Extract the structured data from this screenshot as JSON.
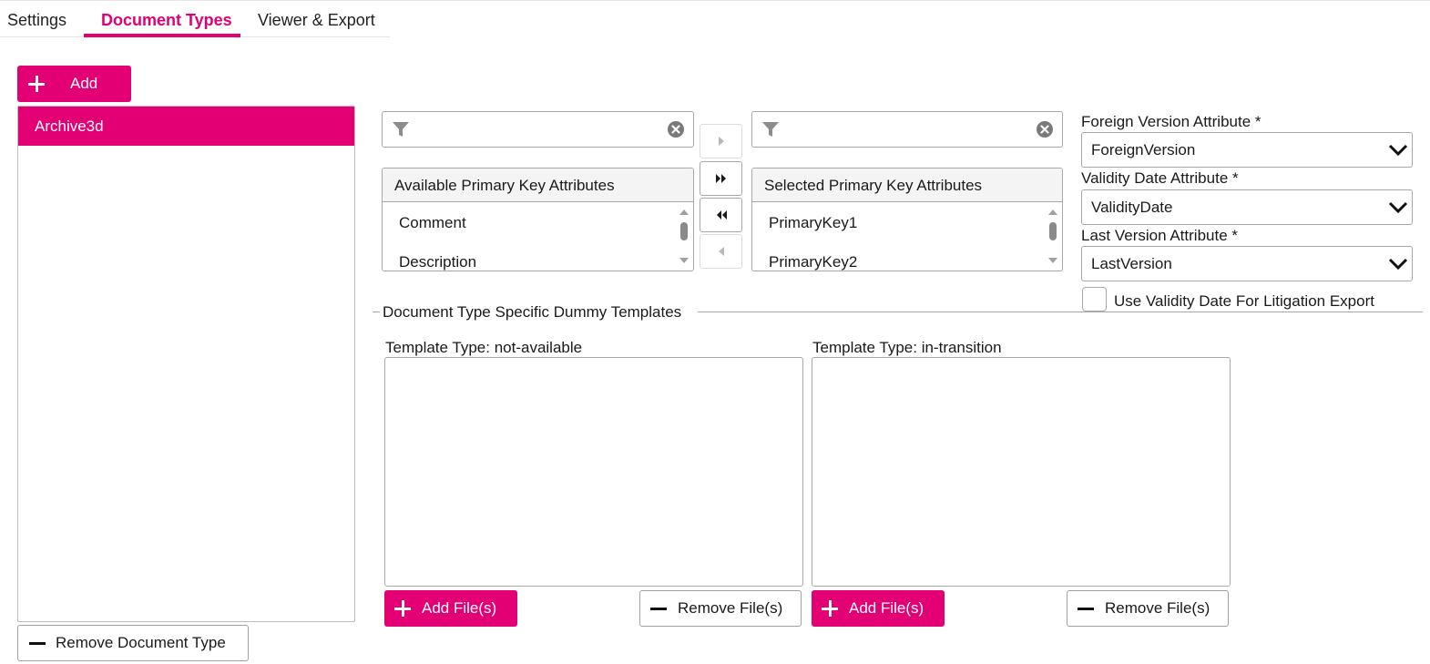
{
  "tabs": [
    {
      "label": "Settings"
    },
    {
      "label": "Document Types"
    },
    {
      "label": "Viewer & Export"
    }
  ],
  "active_tab": "Document Types",
  "colors": {
    "accent": "#e20074",
    "border": "#a8a8a8"
  },
  "left_panel": {
    "add_label": "Add",
    "document_types": [
      "Archive3d"
    ],
    "remove_label": "Remove Document Type"
  },
  "available": {
    "filter_placeholder": "",
    "header": "Available Primary Key Attributes",
    "items": [
      "Comment",
      "Description"
    ]
  },
  "selected": {
    "filter_placeholder": "",
    "header": "Selected Primary Key Attributes",
    "items": [
      "PrimaryKey1",
      "PrimaryKey2"
    ]
  },
  "attributes": {
    "foreign_version_label": "Foreign Version Attribute  *",
    "foreign_version_value": "ForeignVersion",
    "validity_date_label": "Validity Date Attribute  *",
    "validity_date_value": "ValidityDate",
    "last_version_label": "Last Version Attribute  *",
    "last_version_value": "LastVersion",
    "use_validity_label": "Use Validity Date For Litigation Export",
    "use_validity_checked": false
  },
  "templates": {
    "section_title": "Document Type Specific Dummy Templates",
    "not_available_label": "Template Type: not-available",
    "in_transition_label": "Template Type: in-transition",
    "add_files_label": "Add File(s)",
    "remove_files_label": "Remove File(s)"
  }
}
